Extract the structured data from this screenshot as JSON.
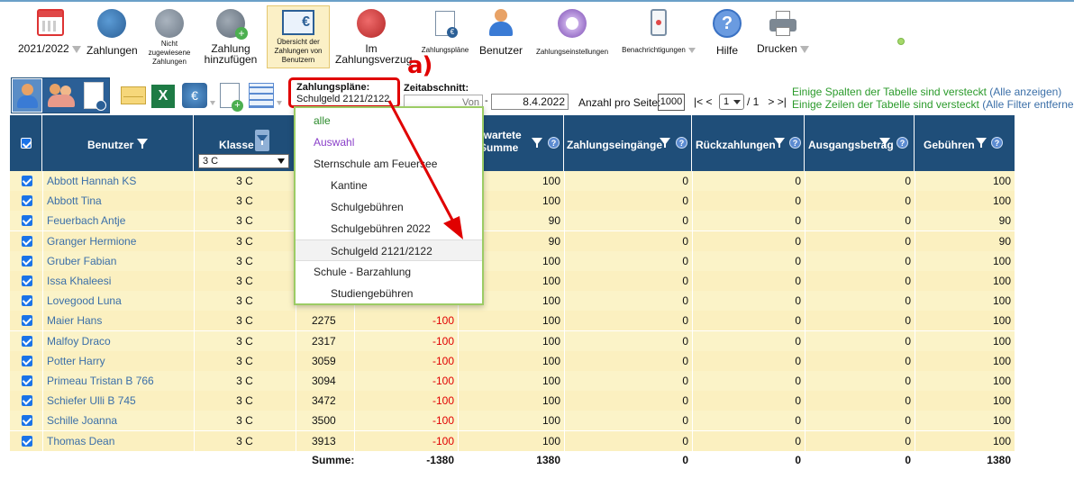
{
  "toolbar": {
    "year": "2021/2022",
    "zahlungen": "Zahlungen",
    "nicht_zugewiesene_1": "Nicht",
    "nicht_zugewiesene_2": "zugewiesene",
    "nicht_zugewiesene_3": "Zahlungen",
    "zahlung_hinzufuegen_1": "Zahlung",
    "zahlung_hinzufuegen_2": "hinzufügen",
    "uebersicht_1": "Übersicht der",
    "uebersicht_2": "Zahlungen von",
    "uebersicht_3": "Benutzern",
    "verzug_1": "Im",
    "verzug_2": "Zahlungsverzug",
    "zahlungsplaene": "Zahlungspläne",
    "benutzer": "Benutzer",
    "zahlungseinstellungen": "Zahlungseinstellungen",
    "benachrichtigungen": "Benachrichtigungen",
    "hilfe": "Hilfe",
    "drucken": "Drucken"
  },
  "annotation": "a)",
  "filters": {
    "plan_label": "Zahlungspläne:",
    "plan_value": "Schulgeld 2121/2122",
    "zeitabschnitt_label": "Zeitabschnitt:",
    "von_placeholder": "Von",
    "date_to": "8.4.2022",
    "anzahl_label": "Anzahl pro Seite:",
    "anzahl_value": "1000",
    "nav_first": "|<",
    "nav_prev": "<",
    "page_value": "1",
    "page_of": "/ 1",
    "nav_next": ">",
    "nav_last": ">|"
  },
  "notices": {
    "cols_text": "Einige Spalten der Tabelle sind versteckt",
    "cols_link": "(Alle anzeigen)",
    "rows_text": "Einige Zeilen der Tabelle sind versteckt",
    "rows_link": "(Alle Filter entfernen)"
  },
  "table": {
    "headers": {
      "benutzer": "Benutzer",
      "klasse": "Klasse",
      "klasse_filter": "3 C",
      "erwartete_1": "rwartete",
      "erwartete_2": "Summe",
      "eingaenge": "Zahlungseingänge",
      "rueck": "Rückzahlungen",
      "ausgang": "Ausgangsbetrag",
      "gebuehren": "Gebühren"
    },
    "rows": [
      {
        "name": "Abbott Hannah KS",
        "klasse": "3 C",
        "nr": "",
        "diff": "",
        "erw": "100",
        "ein": "0",
        "rue": "0",
        "aus": "0",
        "geb": "100"
      },
      {
        "name": "Abbott Tina",
        "klasse": "3 C",
        "nr": "",
        "diff": "",
        "erw": "100",
        "ein": "0",
        "rue": "0",
        "aus": "0",
        "geb": "100"
      },
      {
        "name": "Feuerbach Antje",
        "klasse": "3 C",
        "nr": "",
        "diff": "",
        "erw": "90",
        "ein": "0",
        "rue": "0",
        "aus": "0",
        "geb": "90"
      },
      {
        "name": "Granger Hermione",
        "klasse": "3 C",
        "nr": "",
        "diff": "",
        "erw": "90",
        "ein": "0",
        "rue": "0",
        "aus": "0",
        "geb": "90"
      },
      {
        "name": "Gruber Fabian",
        "klasse": "3 C",
        "nr": "",
        "diff": "",
        "erw": "100",
        "ein": "0",
        "rue": "0",
        "aus": "0",
        "geb": "100"
      },
      {
        "name": "Issa Khaleesi",
        "klasse": "3 C",
        "nr": "",
        "diff": "",
        "erw": "100",
        "ein": "0",
        "rue": "0",
        "aus": "0",
        "geb": "100"
      },
      {
        "name": "Lovegood Luna",
        "klasse": "3 C",
        "nr": "",
        "diff": "",
        "erw": "100",
        "ein": "0",
        "rue": "0",
        "aus": "0",
        "geb": "100"
      },
      {
        "name": "Maier Hans",
        "klasse": "3 C",
        "nr": "2275",
        "diff": "-100",
        "erw": "100",
        "ein": "0",
        "rue": "0",
        "aus": "0",
        "geb": "100"
      },
      {
        "name": "Malfoy Draco",
        "klasse": "3 C",
        "nr": "2317",
        "diff": "-100",
        "erw": "100",
        "ein": "0",
        "rue": "0",
        "aus": "0",
        "geb": "100"
      },
      {
        "name": "Potter Harry",
        "klasse": "3 C",
        "nr": "3059",
        "diff": "-100",
        "erw": "100",
        "ein": "0",
        "rue": "0",
        "aus": "0",
        "geb": "100"
      },
      {
        "name": "Primeau Tristan B 766",
        "klasse": "3 C",
        "nr": "3094",
        "diff": "-100",
        "erw": "100",
        "ein": "0",
        "rue": "0",
        "aus": "0",
        "geb": "100"
      },
      {
        "name": "Schiefer Ulli B 745",
        "klasse": "3 C",
        "nr": "3472",
        "diff": "-100",
        "erw": "100",
        "ein": "0",
        "rue": "0",
        "aus": "0",
        "geb": "100"
      },
      {
        "name": "Schille Joanna",
        "klasse": "3 C",
        "nr": "3500",
        "diff": "-100",
        "erw": "100",
        "ein": "0",
        "rue": "0",
        "aus": "0",
        "geb": "100"
      },
      {
        "name": "Thomas Dean",
        "klasse": "3 C",
        "nr": "3913",
        "diff": "-100",
        "erw": "100",
        "ein": "0",
        "rue": "0",
        "aus": "0",
        "geb": "100"
      }
    ],
    "sum": {
      "label": "Summe:",
      "diff": "-1380",
      "erw": "1380",
      "ein": "0",
      "rue": "0",
      "aus": "0",
      "geb": "1380"
    }
  },
  "dropdown": [
    {
      "label": "alle",
      "style": "green"
    },
    {
      "label": "Auswahl",
      "style": "purple"
    },
    {
      "label": "Sternschule am Feuersee",
      "style": "group"
    },
    {
      "label": "Kantine",
      "style": "sub"
    },
    {
      "label": "Schulgebühren",
      "style": "sub"
    },
    {
      "label": "Schulgebühren 2022",
      "style": "sub"
    },
    {
      "label": "Schulgeld 2121/2122",
      "style": "sub-selected"
    },
    {
      "label": "Schule - Barzahlung",
      "style": "group"
    },
    {
      "label": "Studiengebühren",
      "style": "sub"
    }
  ],
  "colors": {
    "header": "#1f4e79",
    "row": "#fbf3c8",
    "accent": "#1a73e8",
    "negative": "#e00000",
    "link": "#3b6fa8",
    "notice": "#2a9a2a",
    "annotation": "#e00000"
  }
}
